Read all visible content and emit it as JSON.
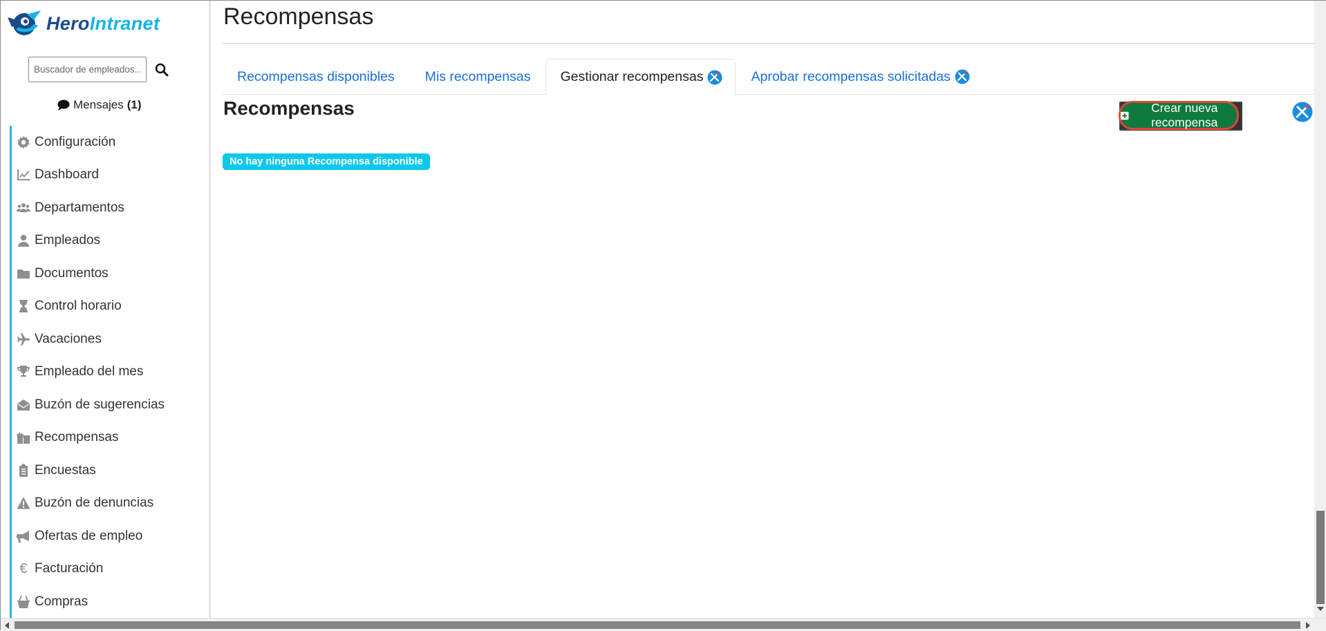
{
  "brand": {
    "name_part1": "Hero",
    "name_part2": "Intranet"
  },
  "search": {
    "placeholder": "Buscador de empleados..."
  },
  "messages": {
    "label": "Mensajes",
    "count": "(1)"
  },
  "sidebar": {
    "items": [
      {
        "label": "Configuración",
        "icon": "gear-icon"
      },
      {
        "label": "Dashboard",
        "icon": "chart-line-icon"
      },
      {
        "label": "Departamentos",
        "icon": "users-icon"
      },
      {
        "label": "Empleados",
        "icon": "user-icon"
      },
      {
        "label": "Documentos",
        "icon": "folder-icon"
      },
      {
        "label": "Control horario",
        "icon": "hourglass-icon"
      },
      {
        "label": "Vacaciones",
        "icon": "plane-icon"
      },
      {
        "label": "Empleado del mes",
        "icon": "trophy-icon"
      },
      {
        "label": "Buzón de sugerencias",
        "icon": "envelope-open-icon"
      },
      {
        "label": "Recompensas",
        "icon": "gifts-icon"
      },
      {
        "label": "Encuestas",
        "icon": "clipboard-list-icon"
      },
      {
        "label": "Buzón de denuncias",
        "icon": "warning-icon"
      },
      {
        "label": "Ofertas de empleo",
        "icon": "megaphone-icon"
      },
      {
        "label": "Facturación",
        "icon": "euro-icon"
      },
      {
        "label": "Compras",
        "icon": "basket-icon"
      }
    ]
  },
  "main": {
    "title": "Recompensas",
    "tabs": [
      {
        "label": "Recompensas disponibles",
        "active": false,
        "tool": false
      },
      {
        "label": "Mis recompensas",
        "active": false,
        "tool": false
      },
      {
        "label": "Gestionar recompensas",
        "active": true,
        "tool": true
      },
      {
        "label": "Aprobar recompensas solicitadas",
        "active": false,
        "tool": true
      }
    ],
    "section_title": "Recompensas",
    "create_button": "Crear nueva recompensa",
    "empty_badge": "No hay ninguna Recompensa disponible"
  },
  "colors": {
    "accent_blue": "#1a6fd6",
    "sidebar_border": "#25b8e0",
    "create_green": "#0e7a3e",
    "highlight_red": "#e0453a",
    "badge_cyan": "#0ec8ec"
  }
}
